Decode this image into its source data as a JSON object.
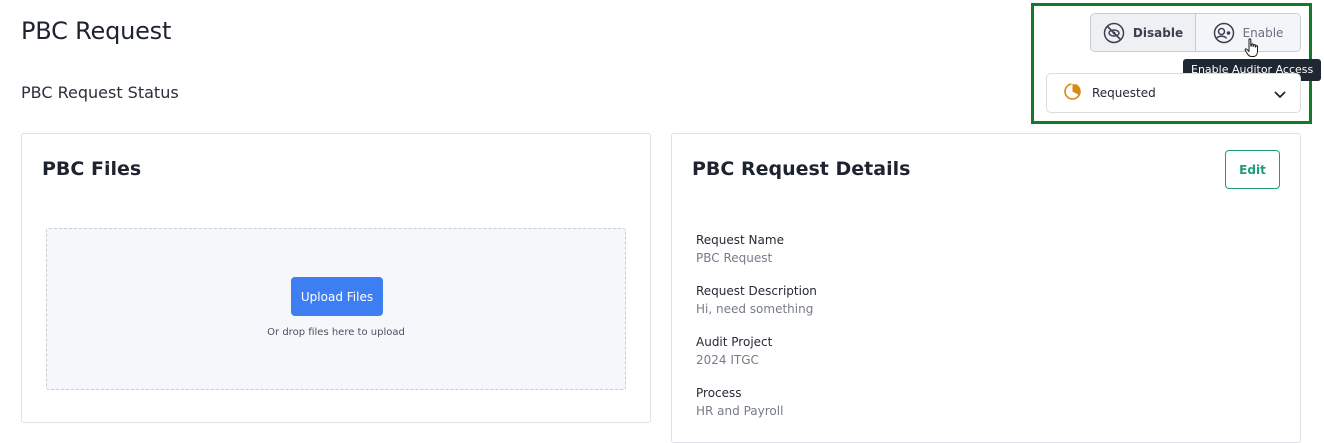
{
  "page": {
    "title": "PBC Request",
    "status_label": "PBC Request Status"
  },
  "auditor_access": {
    "disable_label": "Disable",
    "enable_label": "Enable",
    "tooltip": "Enable Auditor Access",
    "disable_icon": "eye-off-icon",
    "enable_icon": "user-circle-icon",
    "selected": "Enable"
  },
  "status": {
    "selected": "Requested",
    "icon": "progress-clock-icon",
    "accent": "#d78a10"
  },
  "files": {
    "title": "PBC Files",
    "upload_label": "Upload Files",
    "drop_hint": "Or drop files here to upload"
  },
  "details": {
    "title": "PBC Request Details",
    "edit_label": "Edit",
    "fields": [
      {
        "label": "Request Name",
        "value": "PBC Request"
      },
      {
        "label": "Request Description",
        "value": "Hi, need something"
      },
      {
        "label": "Audit Project",
        "value": "2024 ITGC"
      },
      {
        "label": "Process",
        "value": "HR and Payroll"
      }
    ]
  },
  "colors": {
    "highlight": "#137a2c",
    "primary": "#3d7ef2",
    "edit": "#1f9b78"
  }
}
